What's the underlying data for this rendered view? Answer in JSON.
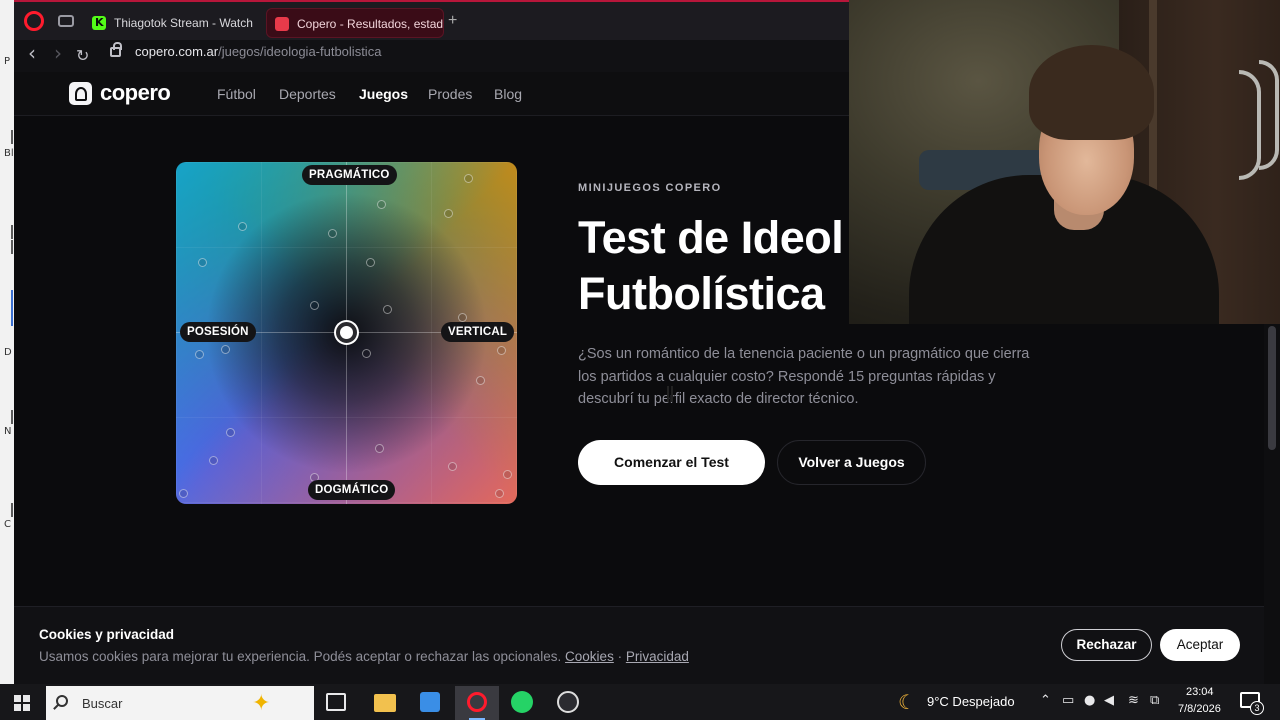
{
  "left_strip": {
    "letters": [
      "P",
      "|",
      "Bl",
      "|",
      "|",
      "|",
      "D",
      "|",
      "N",
      "|",
      "C"
    ]
  },
  "browser": {
    "tabs": [
      {
        "title": "Thiagotok Stream - Watch L",
        "icon": "kick-icon"
      },
      {
        "title": "Copero - Resultados, estad",
        "icon": "copero-icon"
      }
    ],
    "new_tab": "+",
    "back": "‹",
    "forward": "›",
    "reload": "↻",
    "url_host": "copero.com.ar",
    "url_path": "/juegos/ideologia-futbolistica"
  },
  "site": {
    "logo": "copero",
    "nav": [
      "Fútbol",
      "Deportes",
      "Juegos",
      "Prodes",
      "Blog"
    ],
    "active_nav": "Juegos"
  },
  "hero": {
    "eyebrow": "MINIJUEGOS COPERO",
    "title": "Test de Ideología Futbolística",
    "title_line1": "Test de Ideol",
    "title_line2": "Futbolística",
    "description": "¿Sos un romántico de la tenencia paciente o un pragmático que cierra los partidos a cualquier costo? Respondé 15 preguntas rápidas y descubrí tu perfil exacto de director técnico.",
    "primary_button": "Comenzar el Test",
    "secondary_button": "Volver a Juegos"
  },
  "compass": {
    "top": "PRAGMÁTICO",
    "bottom": "DOGMÁTICO",
    "left": "POSESIÓN",
    "right": "VERTICAL"
  },
  "cookie": {
    "title": "Cookies y privacidad",
    "text": "Usamos cookies para mejorar tu experiencia. Podés aceptar o rechazar las opcionales.",
    "link_cookies": "Cookies",
    "separator": "·",
    "link_privacy": "Privacidad",
    "reject": "Rechazar",
    "accept": "Aceptar"
  },
  "taskbar": {
    "search_placeholder": "Buscar",
    "weather": "9°C  Despejado",
    "time": "23:04",
    "date": "7/8/2026",
    "notifications": "3",
    "pinned": [
      "task-view-icon",
      "file-explorer-icon",
      "store-icon",
      "opera-icon",
      "whatsapp-icon",
      "obs-icon"
    ]
  },
  "colors": {
    "accent": "#b7163a",
    "page_bg": "#0b0b0d",
    "taskbar_bg": "#17171a"
  }
}
